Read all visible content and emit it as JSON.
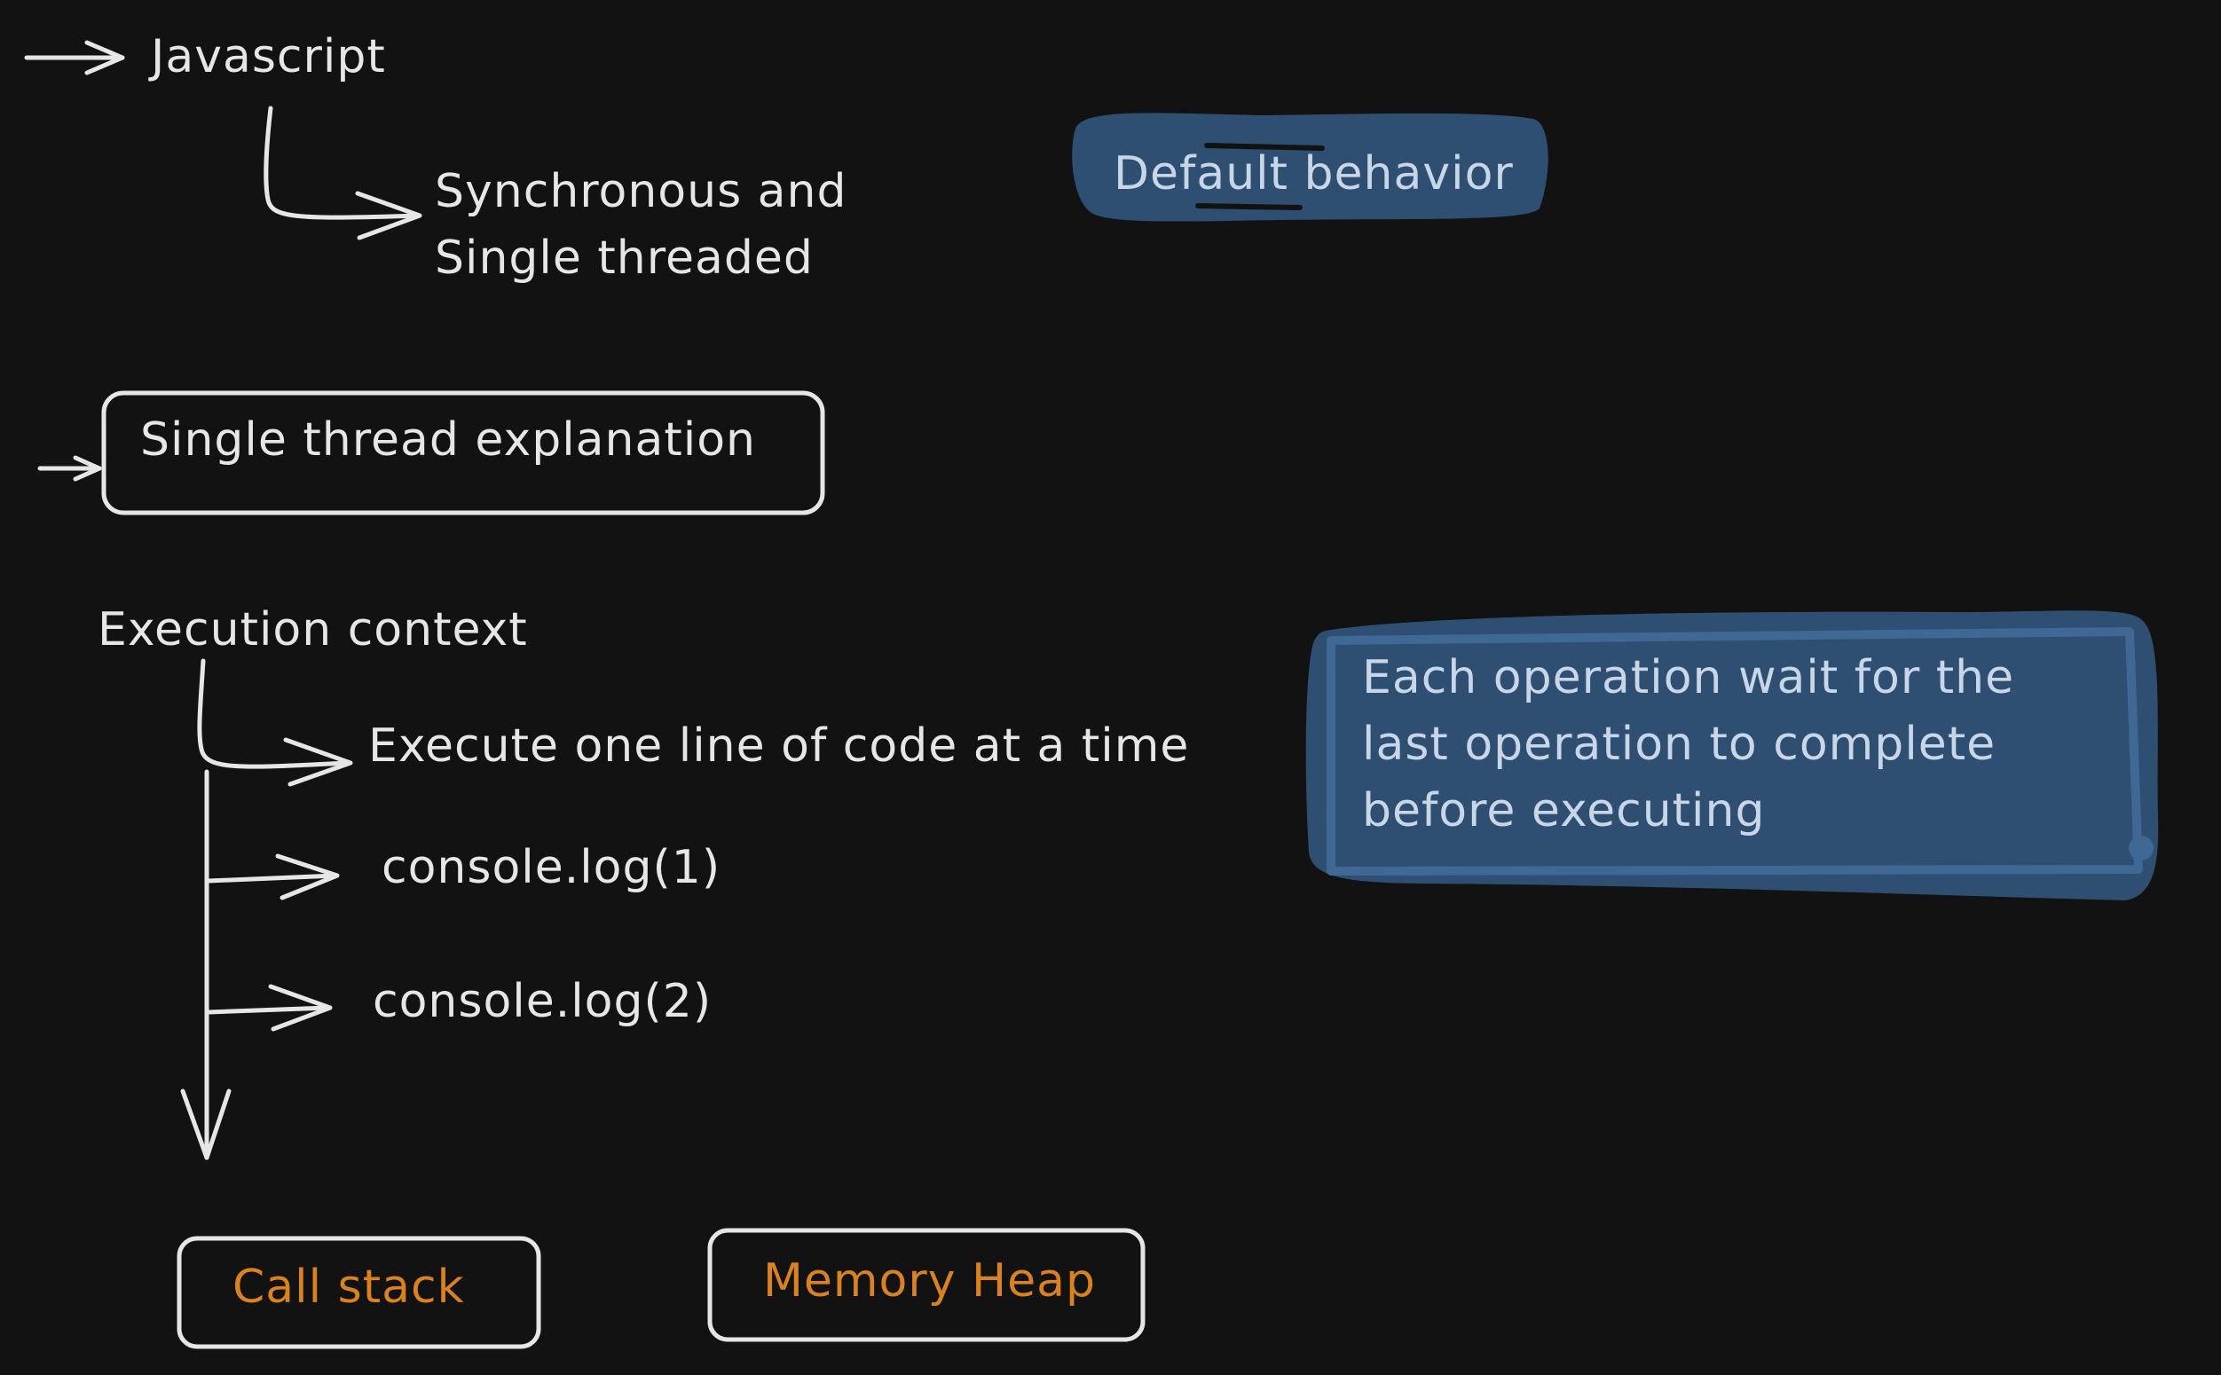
{
  "colors": {
    "background": "#121212",
    "stroke": "#e6e6e6",
    "orange_text": "#d9821f",
    "note_fill": "#2f4f72",
    "note_text": "#c8d6e8"
  },
  "root": {
    "label": "Javascript",
    "child_line1": "Synchronous and",
    "child_line2": "Single threaded"
  },
  "tag_default": "Default behavior",
  "box_single_thread": "Single thread explanation",
  "execution": {
    "title": "Execution context",
    "line1": "Execute one line of code at a time",
    "step1": "console.log(1)",
    "step2": "console.log(2)"
  },
  "note": {
    "line1": "Each operation wait for the",
    "line2": "last operation to complete",
    "line3": "before executing"
  },
  "boxes": {
    "call_stack": "Call stack",
    "memory_heap": "Memory Heap"
  }
}
